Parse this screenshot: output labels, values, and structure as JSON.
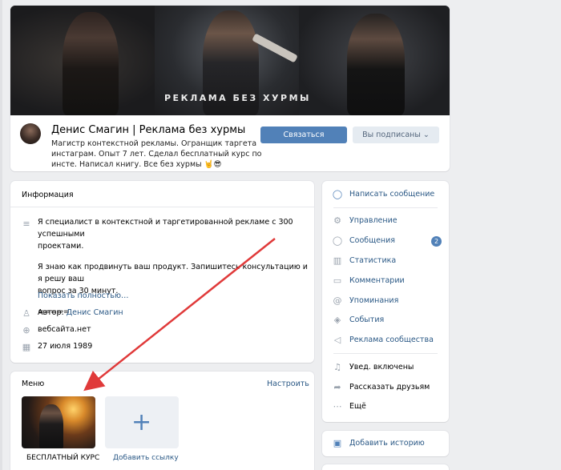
{
  "header": {
    "cover_title": "РЕКЛАМА БЕЗ ХУРМЫ",
    "group_name": "Денис Смагин | Реклама без хурмы",
    "status": "Магистр контекстной рекламы. Огранщик таргета инстаграм. Опыт 7 лет. Сделал бесплатный курс по инсте. Написал книгу. Все без хурмы 🤘😎",
    "join_label": "Связаться",
    "subscribed_label": "Вы подписаны ⌄"
  },
  "info": {
    "title": "Информация",
    "description_lines": [
      "Я специалист в контекстной и таргетированной рекламе с 300 успешными",
      "проектами.",
      "",
      "Я знаю как продвинуть ваш продукт. Запишитесь консультацию и я решу ваш",
      "вопрос за 30 минут.",
      "",
      "====="
    ],
    "show_more": "Показать полностью…",
    "author_prefix": "Автор: ",
    "author_name": "Денис Смагин",
    "website": "вебсайта.нет",
    "date": "27 июля 1989"
  },
  "menu": {
    "title": "Меню",
    "settings_link": "Настроить",
    "items": [
      {
        "label": "БЕСПЛАТНЫЙ КУРС"
      },
      {
        "label": "Добавить ссылку"
      }
    ]
  },
  "actions": {
    "primary": {
      "label": "Написать сообщение",
      "icon": "message-icon"
    },
    "items": [
      {
        "label": "Управление",
        "icon": "gear-icon"
      },
      {
        "label": "Сообщения",
        "icon": "chat-icon",
        "badge": "2"
      },
      {
        "label": "Статистика",
        "icon": "stats-icon"
      },
      {
        "label": "Комментарии",
        "icon": "comment-icon"
      },
      {
        "label": "Упоминания",
        "icon": "at-icon"
      },
      {
        "label": "События",
        "icon": "events-icon"
      },
      {
        "label": "Реклама сообщества",
        "icon": "megaphone-icon"
      }
    ],
    "secondary": [
      {
        "label": "Увед. включены",
        "icon": "bell-icon"
      },
      {
        "label": "Рассказать друзьям",
        "icon": "share-icon"
      },
      {
        "label": "Ещё",
        "icon": "more-icon"
      }
    ]
  },
  "story": {
    "label": "Добавить историю",
    "icon": "instagram-icon"
  },
  "colors": {
    "accent": "#5181b8",
    "link": "#2a5885",
    "background": "#edeef0",
    "arrow": "#e03a3a"
  }
}
